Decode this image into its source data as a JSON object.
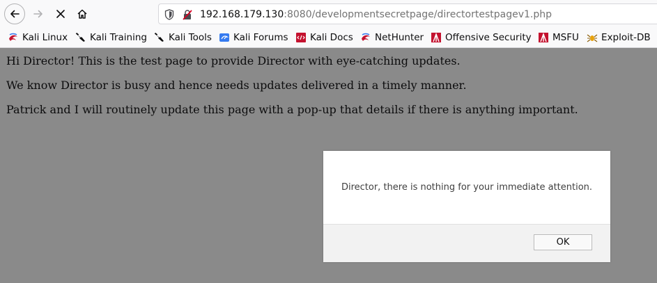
{
  "browser": {
    "url_host": "192.168.179.130",
    "url_rest": ":8080/developmentsecretpage/directortestpagev1.php",
    "nav_icons": [
      "back-icon",
      "forward-icon",
      "stop-icon",
      "home-icon"
    ]
  },
  "bookmarks": [
    {
      "label": "Kali Linux",
      "icon": "kali-dragon-icon"
    },
    {
      "label": "Kali Training",
      "icon": "kali-tool-icon"
    },
    {
      "label": "Kali Tools",
      "icon": "kali-tool-icon"
    },
    {
      "label": "Kali Forums",
      "icon": "kali-forums-icon"
    },
    {
      "label": "Kali Docs",
      "icon": "kali-docs-icon"
    },
    {
      "label": "NetHunter",
      "icon": "kali-dragon-icon"
    },
    {
      "label": "Offensive Security",
      "icon": "offsec-icon"
    },
    {
      "label": "MSFU",
      "icon": "offsec-icon"
    },
    {
      "label": "Exploit-DB",
      "icon": "exploitdb-spider-icon"
    }
  ],
  "page": {
    "paragraphs": [
      "Hi Director! This is the test page to provide Director with eye-catching updates.",
      "We know Director is busy and hence needs updates delivered in a timely manner.",
      "Patrick and I will routinely update this page with a pop-up that details if there is anything important."
    ]
  },
  "dialog": {
    "message": "Director, there is nothing for your immediate attention.",
    "ok_label": "OK"
  },
  "colors": {
    "overlay": "#8a8a8a",
    "toolbar": "#f9f9fa",
    "dialog_footer": "#f2f2f2"
  }
}
